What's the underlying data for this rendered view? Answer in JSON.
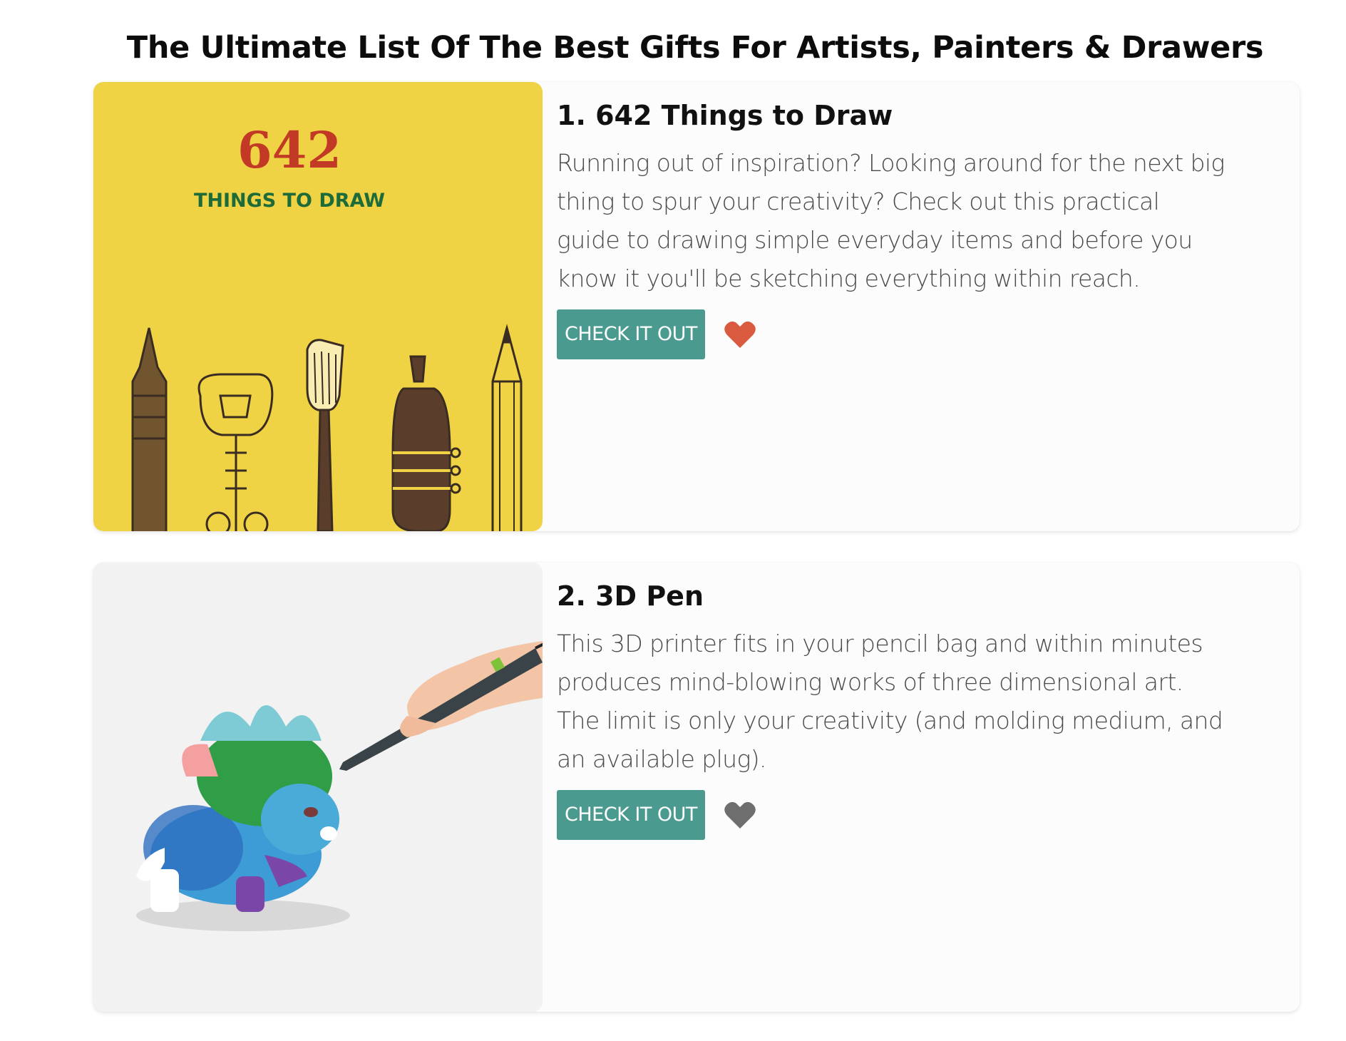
{
  "page": {
    "title": "The Ultimate List Of The Best Gifts For Artists, Painters & Drawers"
  },
  "colors": {
    "accent_button": "#4a9a90",
    "heart_active": "#d95a3e",
    "heart_inactive": "#6e6e6e",
    "card1_bg": "#efd344",
    "card2_bg": "#f2f2f2"
  },
  "items": [
    {
      "title": "1. 642 Things to Draw",
      "description": "Running out of inspiration? Looking around for the next big thing to spur your creativity? Check out this practical guide to drawing simple everyday items and before you know it you'll be sketching everything within reach.",
      "button_label": "CHECK IT OUT",
      "favorite_icon": "heart-icon",
      "favorited": true,
      "image": {
        "cover_number": "642",
        "cover_subtitle": "THINGS TO DRAW"
      }
    },
    {
      "title": "2. 3D Pen",
      "description": "This 3D printer fits in your pencil bag and within minutes produces mind-blowing works of three dimensional art. The limit is only your creativity (and molding medium, and an available plug).",
      "button_label": "CHECK IT OUT",
      "favorite_icon": "heart-icon",
      "favorited": false
    }
  ]
}
